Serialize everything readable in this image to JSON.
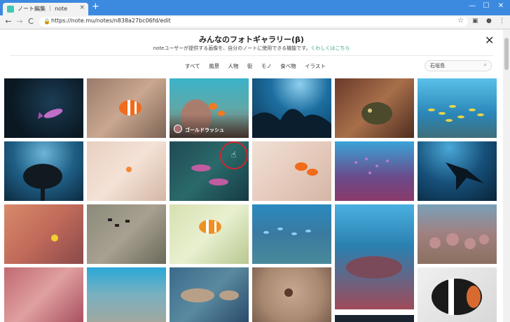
{
  "browser": {
    "tab_title": "ノート編集 ｜ note",
    "tab_close": "×",
    "new_tab": "+",
    "url": "https://note.mu/notes/n838a27bc06fd/edit",
    "back": "←",
    "forward": "→",
    "reload": "C",
    "minimize": "—",
    "maximize": "☐",
    "close": "✕"
  },
  "gallery": {
    "title": "みんなのフォトギャラリー(β)",
    "subtitle": "noteユーザーが提供する画像を、自分のノートに使用できる機能です。",
    "subtitle_link": "くわしくはこちら",
    "close": "✕",
    "categories": [
      "すべて",
      "風景",
      "人物",
      "街",
      "モノ",
      "食べ物",
      "イラスト"
    ],
    "search_value": "石垣島",
    "hover_user": "ゴールドラッシュ"
  },
  "colors": {
    "titlebar": "#3c8ae0",
    "link": "#2fa58c",
    "cursor_ring": "#d0262e"
  }
}
